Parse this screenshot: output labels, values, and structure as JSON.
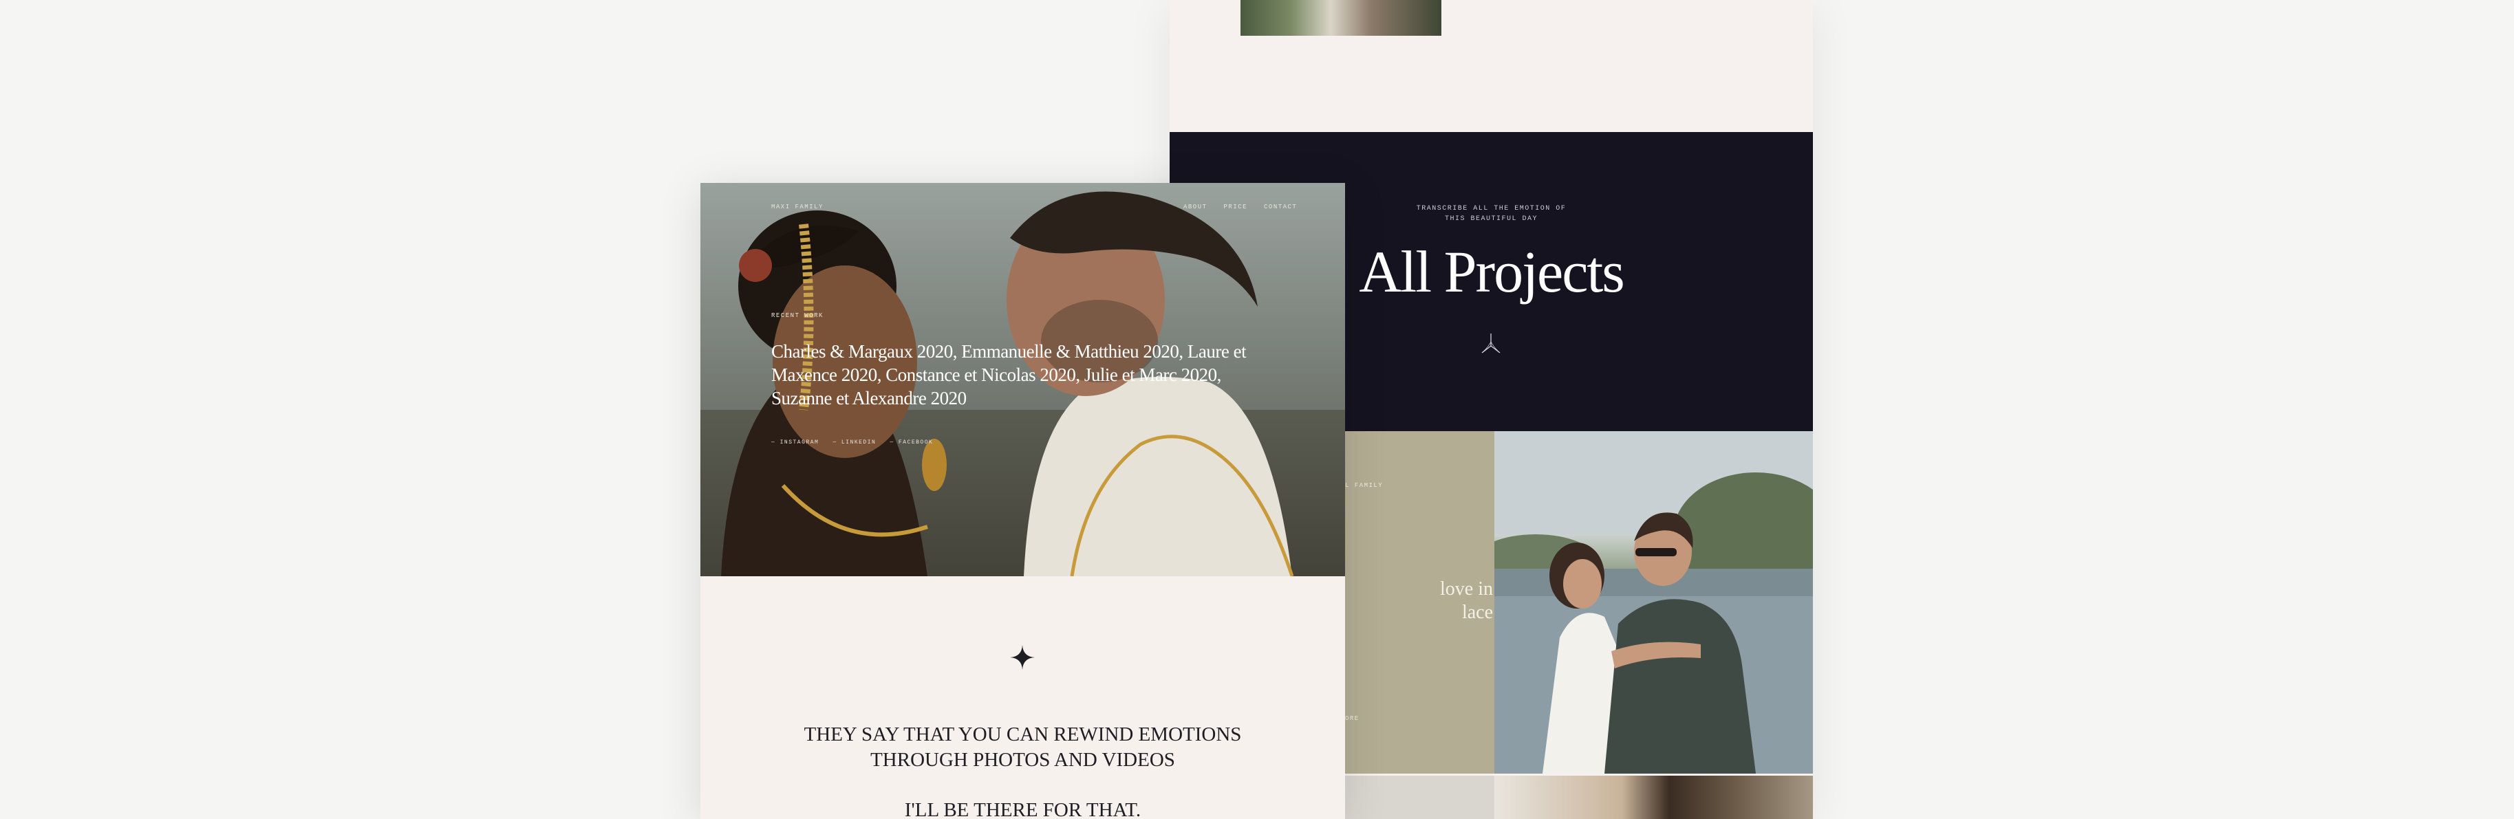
{
  "back_card": {
    "tagline_line1": "TRANSCRIBE ALL THE EMOTION OF",
    "tagline_line2": "THIS BEAUTIFUL DAY",
    "title": "All Projects",
    "khaki_label": "L FAMILY",
    "khaki_text_line1": "love in",
    "khaki_text_line2": "lace",
    "khaki_foot": "ORE"
  },
  "front_card": {
    "brand": "MAXI FAMILY",
    "nav": [
      "ABOUT",
      "PRICE",
      "CONTACT"
    ],
    "kicker": "RECENT WORK",
    "hero_title": "Charles & Margaux 2020, Emmanuelle & Matthieu 2020, Laure et Maxence 2020, Constance et Nicolas 2020, Julie et Marc 2020, Suzanne et Alexandre 2020",
    "social": [
      "— INSTAGRAM",
      "— LINKEDIN",
      "— FACEBOOK"
    ],
    "quote_line1": "THEY SAY THAT YOU CAN REWIND EMOTIONS",
    "quote_line2": "THROUGH PHOTOS AND VIDEOS",
    "quote_line3": "I'LL BE THERE FOR THAT."
  },
  "colors": {
    "page_bg": "#f5f5f4",
    "cream": "#f6f1ed",
    "dark_navy": "#14131f",
    "khaki": "#b3ad93"
  }
}
